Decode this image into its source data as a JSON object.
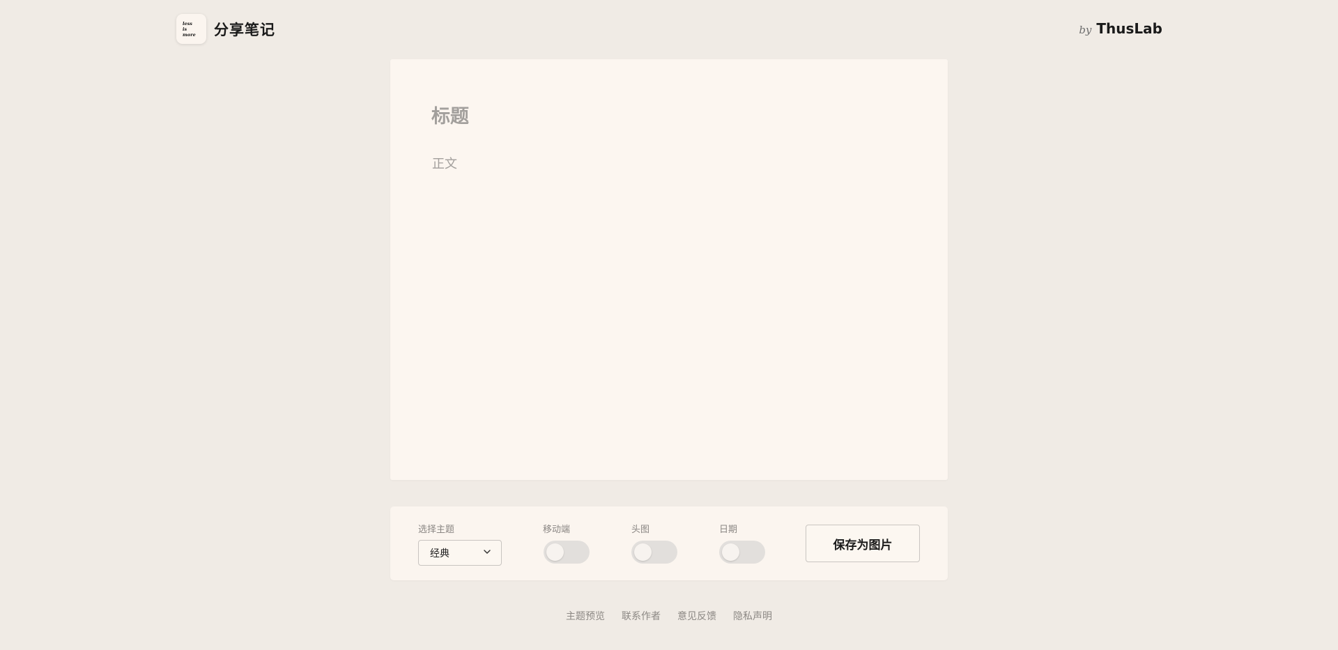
{
  "header": {
    "logo_lines": [
      "less",
      "is",
      "more"
    ],
    "app_title": "分享笔记",
    "by_text": "by",
    "author_brand": "ThusLab"
  },
  "note": {
    "title_placeholder": "标题",
    "body_placeholder": "正文"
  },
  "controls": {
    "theme_label": "选择主题",
    "theme_selected": "经典",
    "mobile_label": "移动端",
    "mobile_on": false,
    "avatar_label": "头图",
    "avatar_on": false,
    "date_label": "日期",
    "date_on": false,
    "save_label": "保存为图片"
  },
  "footer": {
    "links": [
      "主题预览",
      "联系作者",
      "意见反馈",
      "隐私声明"
    ]
  },
  "icons": {
    "select": "chevron-down-icon"
  }
}
